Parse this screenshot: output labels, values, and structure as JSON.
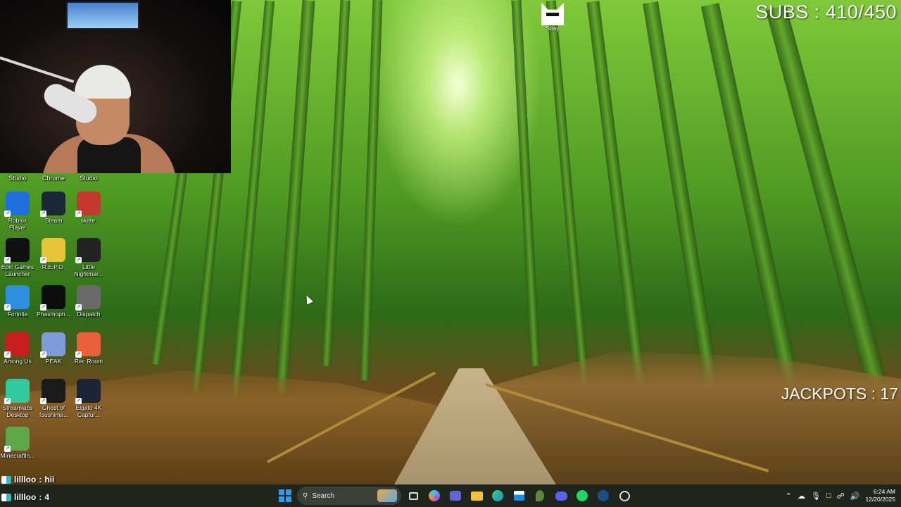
{
  "overlays": {
    "subs": "SUBS : 410/450",
    "jackpots": "JACKPOTS : 17"
  },
  "desktop": {
    "top_labels": [
      "Studio",
      "Chrome",
      "Studio"
    ],
    "icons": [
      {
        "label": "Roblox Player",
        "icon": "roblox-icon",
        "color": "#1f6fe0"
      },
      {
        "label": "Steam",
        "icon": "steam-icon",
        "color": "#1b2838"
      },
      {
        "label": "skate.",
        "icon": "skate-icon",
        "color": "#c23a2e"
      },
      {
        "label": "Epic Games Launcher",
        "icon": "epic-games-icon",
        "color": "#111111"
      },
      {
        "label": "R.E.P.O.",
        "icon": "repo-icon",
        "color": "#e8c43a"
      },
      {
        "label": "Little Nightmar...",
        "icon": "little-nightmares-icon",
        "color": "#222222"
      },
      {
        "label": "Fortnite",
        "icon": "fortnite-icon",
        "color": "#2e8fe0"
      },
      {
        "label": "Phasmoph...",
        "icon": "phasmophobia-icon",
        "color": "#0d0d0d"
      },
      {
        "label": "Dispatch",
        "icon": "dispatch-icon",
        "color": "#6a6a6a"
      },
      {
        "label": "Among Us",
        "icon": "among-us-icon",
        "color": "#c81d1d"
      },
      {
        "label": "PEAK",
        "icon": "peak-icon",
        "color": "#7f9bd8"
      },
      {
        "label": "Rec Room",
        "icon": "rec-room-icon",
        "color": "#e8603c"
      },
      {
        "label": "Streamlabs Desktop",
        "icon": "streamlabs-icon",
        "color": "#30c9a0"
      },
      {
        "label": "Ghost of Tsushima...",
        "icon": "ghost-of-tsushima-icon",
        "color": "#1a1a1a"
      },
      {
        "label": "Elgato 4K Captur...",
        "icon": "elgato-icon",
        "color": "#1d2438"
      },
      {
        "label": "Minecraftln...",
        "icon": "minecraft-icon",
        "color": "#5fa84a"
      }
    ],
    "stray": {
      "label": "Stray"
    }
  },
  "chat": [
    {
      "user": "lillloo",
      "message": "hii"
    },
    {
      "user": "lillloo",
      "message": "4"
    }
  ],
  "taskbar": {
    "search_label": "Search",
    "time": "6:24 AM",
    "date": "12/20/2025"
  }
}
